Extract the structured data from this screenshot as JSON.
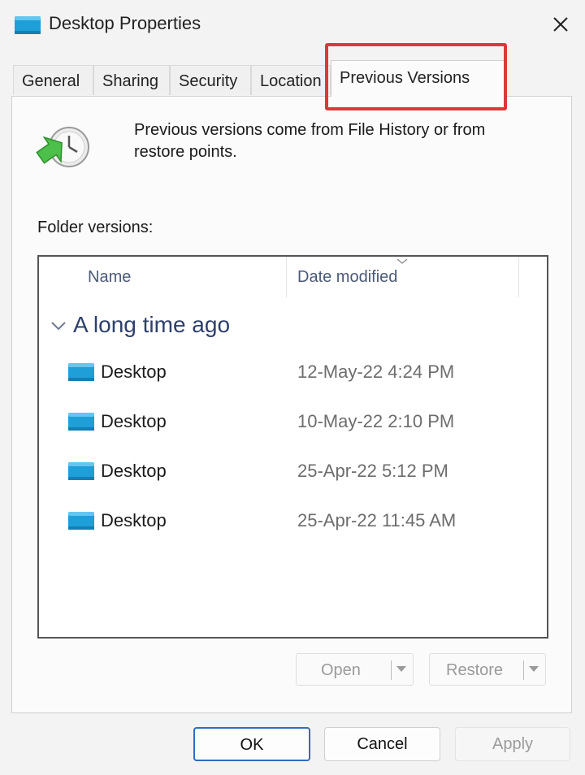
{
  "window": {
    "title": "Desktop Properties",
    "title_icon": "desktop-folder-icon",
    "close_icon": "close-icon"
  },
  "tabs": [
    {
      "label": "General"
    },
    {
      "label": "Sharing"
    },
    {
      "label": "Security"
    },
    {
      "label": "Location"
    },
    {
      "label": "Previous Versions",
      "active": true
    }
  ],
  "panel": {
    "description": "Previous versions come from File History or from restore points.",
    "history_icon": "restore-history-icon",
    "folder_versions_label": "Folder versions:"
  },
  "list": {
    "columns": {
      "name": "Name",
      "date": "Date modified"
    },
    "group": "A long time ago",
    "rows": [
      {
        "name": "Desktop",
        "date": "12-May-22 4:24 PM"
      },
      {
        "name": "Desktop",
        "date": "10-May-22 2:10 PM"
      },
      {
        "name": "Desktop",
        "date": "25-Apr-22 5:12 PM"
      },
      {
        "name": "Desktop",
        "date": "25-Apr-22 11:45 AM"
      }
    ]
  },
  "actions": {
    "open": "Open",
    "restore": "Restore"
  },
  "dialog_buttons": {
    "ok": "OK",
    "cancel": "Cancel",
    "apply": "Apply"
  },
  "colors": {
    "highlight": "#d93a3a",
    "folder": "#1e9fd8",
    "group_text": "#2d3f6e",
    "ok_border": "#2f6ebd"
  }
}
